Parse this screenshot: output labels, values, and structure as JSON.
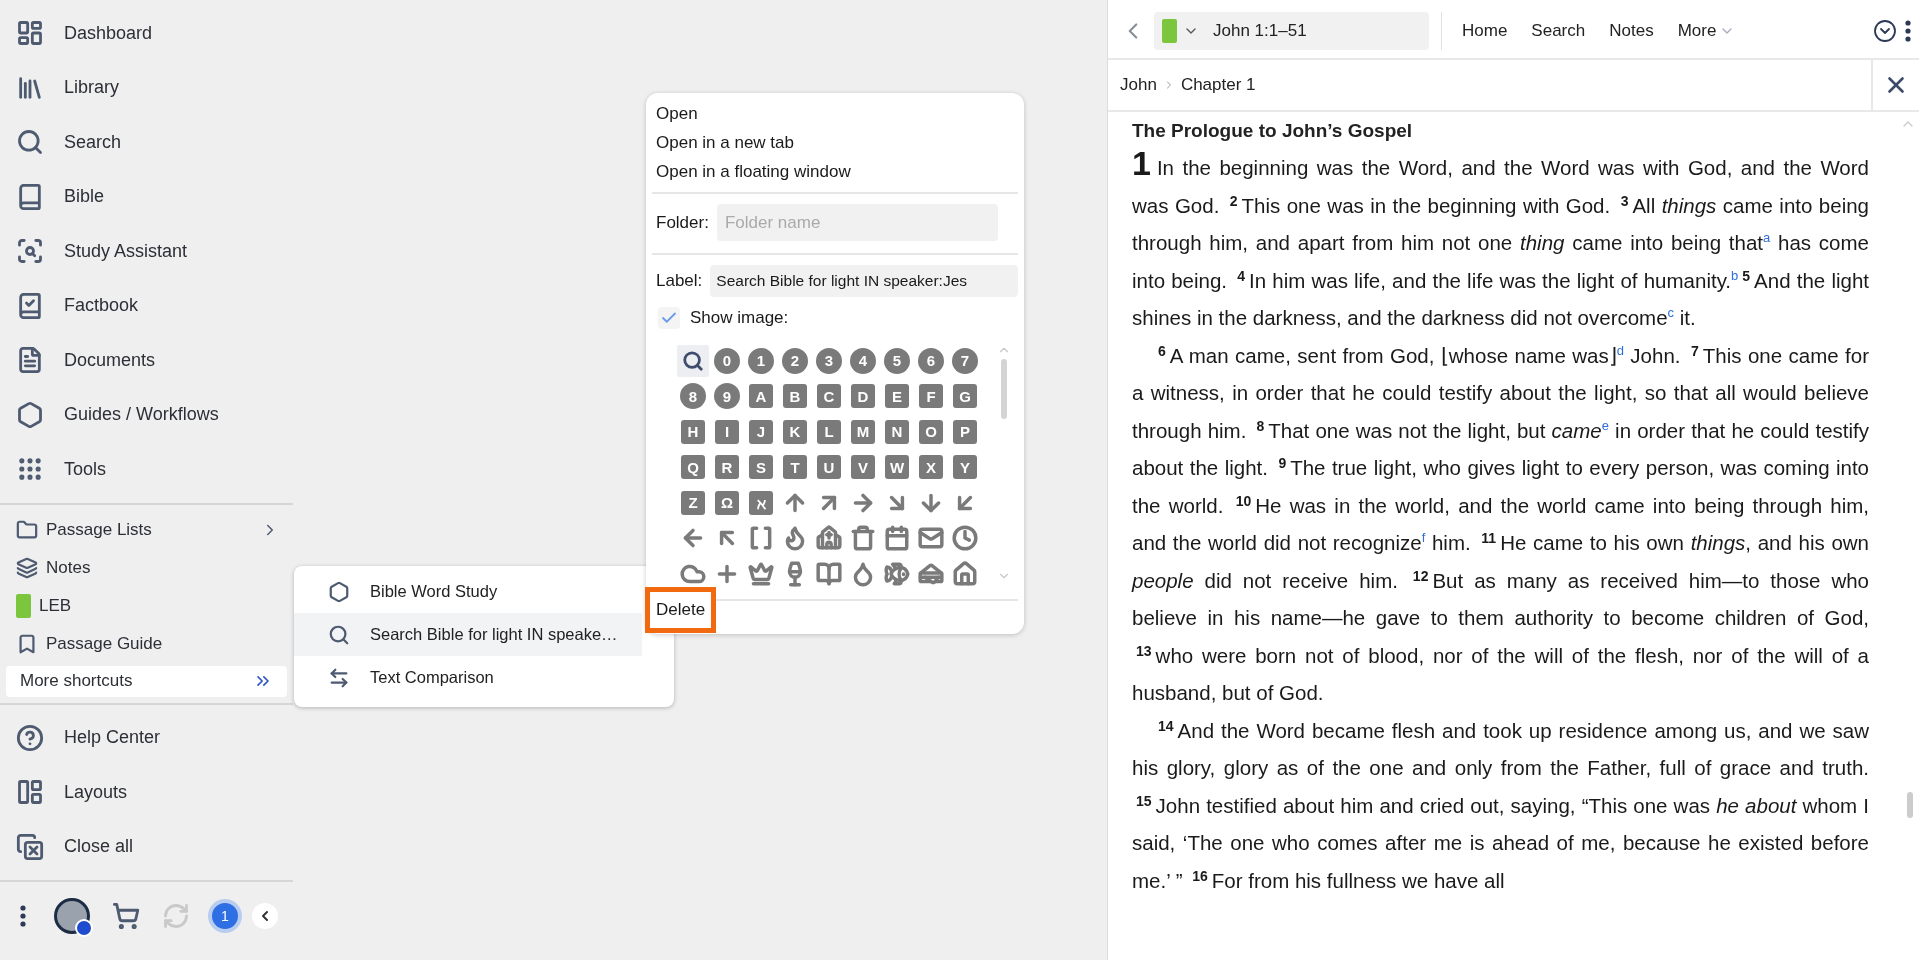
{
  "sidebar": {
    "nav": [
      {
        "label": "Dashboard"
      },
      {
        "label": "Library"
      },
      {
        "label": "Search"
      },
      {
        "label": "Bible"
      },
      {
        "label": "Study Assistant"
      },
      {
        "label": "Factbook"
      },
      {
        "label": "Documents"
      },
      {
        "label": "Guides / Workflows"
      },
      {
        "label": "Tools"
      }
    ],
    "shortcuts": [
      {
        "label": "Passage Lists",
        "kind": "folder",
        "selected": false
      },
      {
        "label": "Notes",
        "kind": "item",
        "selected": false
      },
      {
        "label": "LEB",
        "kind": "item",
        "selected": false
      },
      {
        "label": "Passage Guide",
        "kind": "item",
        "selected": false
      },
      {
        "label": "More shortcuts",
        "kind": "more",
        "selected": true
      }
    ],
    "footer": [
      {
        "label": "Help Center"
      },
      {
        "label": "Layouts"
      },
      {
        "label": "Close all"
      }
    ],
    "bottom_bar": {
      "notification_count": "1"
    }
  },
  "shortcut_menu": {
    "items": [
      {
        "label": "Bible Word Study",
        "selected": false
      },
      {
        "label": "Search Bible for light IN speake…",
        "selected": true
      },
      {
        "label": "Text Comparison",
        "selected": false
      }
    ]
  },
  "shortcut_editor": {
    "actions": [
      "Open",
      "Open in a new tab",
      "Open in a floating window"
    ],
    "folder": {
      "label": "Folder:",
      "placeholder": "Folder name"
    },
    "label_field": {
      "label": "Label:",
      "value": "Search Bible for light IN speaker:Jes"
    },
    "show_image": {
      "label": "Show image:",
      "checked": true
    },
    "images": [
      {
        "kind": "search",
        "selected": true
      },
      {
        "kind": "circle",
        "text": "0",
        "selected": false
      },
      {
        "kind": "circle",
        "text": "1",
        "selected": false
      },
      {
        "kind": "circle",
        "text": "2",
        "selected": false
      },
      {
        "kind": "circle",
        "text": "3",
        "selected": false
      },
      {
        "kind": "circle",
        "text": "4",
        "selected": false
      },
      {
        "kind": "circle",
        "text": "5",
        "selected": false
      },
      {
        "kind": "circle",
        "text": "6",
        "selected": false
      },
      {
        "kind": "circle",
        "text": "7",
        "selected": false
      },
      {
        "kind": "circle",
        "text": "8",
        "selected": false
      },
      {
        "kind": "circle",
        "text": "9",
        "selected": false
      },
      {
        "kind": "square",
        "text": "A",
        "selected": false
      },
      {
        "kind": "square",
        "text": "B",
        "selected": false
      },
      {
        "kind": "square",
        "text": "C",
        "selected": false
      },
      {
        "kind": "square",
        "text": "D",
        "selected": false
      },
      {
        "kind": "square",
        "text": "E",
        "selected": false
      },
      {
        "kind": "square",
        "text": "F",
        "selected": false
      },
      {
        "kind": "square",
        "text": "G",
        "selected": false
      },
      {
        "kind": "square",
        "text": "H",
        "selected": false
      },
      {
        "kind": "square",
        "text": "I",
        "selected": false
      },
      {
        "kind": "square",
        "text": "J",
        "selected": false
      },
      {
        "kind": "square",
        "text": "K",
        "selected": false
      },
      {
        "kind": "square",
        "text": "L",
        "selected": false
      },
      {
        "kind": "square",
        "text": "M",
        "selected": false
      },
      {
        "kind": "square",
        "text": "N",
        "selected": false
      },
      {
        "kind": "square",
        "text": "O",
        "selected": false
      },
      {
        "kind": "square",
        "text": "P",
        "selected": false
      },
      {
        "kind": "square",
        "text": "Q",
        "selected": false
      },
      {
        "kind": "square",
        "text": "R",
        "selected": false
      },
      {
        "kind": "square",
        "text": "S",
        "selected": false
      },
      {
        "kind": "square",
        "text": "T",
        "selected": false
      },
      {
        "kind": "square",
        "text": "U",
        "selected": false
      },
      {
        "kind": "square",
        "text": "V",
        "selected": false
      },
      {
        "kind": "square",
        "text": "W",
        "selected": false
      },
      {
        "kind": "square",
        "text": "X",
        "selected": false
      },
      {
        "kind": "square",
        "text": "Y",
        "selected": false
      },
      {
        "kind": "square",
        "text": "Z",
        "selected": false
      },
      {
        "kind": "square",
        "text": "Ω",
        "selected": false
      },
      {
        "kind": "square",
        "text": "ℵ",
        "selected": false
      },
      {
        "kind": "glyph",
        "selected": false
      },
      {
        "kind": "glyph",
        "selected": false
      },
      {
        "kind": "glyph",
        "selected": false
      },
      {
        "kind": "glyph",
        "selected": false
      },
      {
        "kind": "glyph",
        "selected": false
      },
      {
        "kind": "glyph",
        "selected": false
      },
      {
        "kind": "glyph",
        "selected": false
      },
      {
        "kind": "glyph",
        "selected": false
      },
      {
        "kind": "glyph",
        "selected": false
      },
      {
        "kind": "glyph",
        "selected": false
      },
      {
        "kind": "glyph",
        "selected": false
      },
      {
        "kind": "glyph",
        "selected": false
      },
      {
        "kind": "glyph",
        "selected": false
      },
      {
        "kind": "glyph",
        "selected": false
      },
      {
        "kind": "glyph",
        "selected": false
      },
      {
        "kind": "glyph",
        "selected": false
      },
      {
        "kind": "glyph",
        "selected": false
      },
      {
        "kind": "glyph",
        "selected": false
      },
      {
        "kind": "glyph",
        "selected": false
      },
      {
        "kind": "glyph",
        "selected": false
      },
      {
        "kind": "glyph",
        "selected": false
      },
      {
        "kind": "glyph",
        "selected": false
      },
      {
        "kind": "glyph",
        "selected": false
      },
      {
        "kind": "glyph",
        "selected": false
      }
    ],
    "delete_button": "Delete"
  },
  "reader": {
    "toolbar": {
      "resource": "John 1:1–51",
      "tabs": [
        {
          "label": "Home",
          "kind": "link"
        },
        {
          "label": "Search",
          "kind": "link"
        },
        {
          "label": "Notes",
          "kind": "link"
        },
        {
          "label": "More",
          "kind": "menu"
        }
      ]
    },
    "breadcrumb": [
      "John",
      "Chapter 1"
    ],
    "heading": "The Prologue to John’s Gospel",
    "paragraphs": [
      {
        "indent": false,
        "segments": [
          {
            "kind": "chapter",
            "text": "1"
          },
          {
            "kind": "text",
            "text": "In the beginning was the Word, and the Word was with God, and the Word was God. "
          },
          {
            "kind": "verse",
            "text": "2"
          },
          {
            "kind": "text",
            "text": "This one was in the beginning with God. "
          },
          {
            "kind": "verse",
            "text": "3"
          },
          {
            "kind": "text",
            "text": "All *things* came into being through him, and apart from him not one *thing* came into being that"
          },
          {
            "kind": "note",
            "text": "a"
          },
          {
            "kind": "text",
            "text": " has come into being. "
          },
          {
            "kind": "verse",
            "text": "4"
          },
          {
            "kind": "text",
            "text": "In him was life, and the life was the light of humanity."
          },
          {
            "kind": "note",
            "text": "b"
          },
          {
            "kind": "verse",
            "text": "5"
          },
          {
            "kind": "text",
            "text": "And the light shines in the darkness, and the darkness did not overcome"
          },
          {
            "kind": "note",
            "text": "c"
          },
          {
            "kind": "text",
            "text": " it."
          }
        ]
      },
      {
        "indent": true,
        "segments": [
          {
            "kind": "verse",
            "text": "6"
          },
          {
            "kind": "text",
            "text": "A man came, sent from God, ⌊whose name was⌋"
          },
          {
            "kind": "note",
            "text": "d"
          },
          {
            "kind": "text",
            "text": " John. "
          },
          {
            "kind": "verse",
            "text": "7"
          },
          {
            "kind": "text",
            "text": "This one came for a witness, in order that he could testify about the light, so that all would believe through him. "
          },
          {
            "kind": "verse",
            "text": "8"
          },
          {
            "kind": "text",
            "text": "That one was not the light, but *came*"
          },
          {
            "kind": "note",
            "text": "e"
          },
          {
            "kind": "text",
            "text": " in order that he could testify about the light. "
          },
          {
            "kind": "verse",
            "text": "9"
          },
          {
            "kind": "text",
            "text": "The true light, who gives light to every person, was coming into the world. "
          },
          {
            "kind": "verse",
            "text": "10"
          },
          {
            "kind": "text",
            "text": "He was in the world, and the world came into being through him, and the world did not recognize"
          },
          {
            "kind": "note",
            "text": "f"
          },
          {
            "kind": "text",
            "text": " him. "
          },
          {
            "kind": "verse",
            "text": "11"
          },
          {
            "kind": "text",
            "text": "He came to his own *things*, and his own *people* did not receive him. "
          },
          {
            "kind": "verse",
            "text": "12"
          },
          {
            "kind": "text",
            "text": "But as many as received him—to those who believe in his name—he gave to them authority to become children of God, "
          },
          {
            "kind": "verse",
            "text": "13"
          },
          {
            "kind": "text",
            "text": "who were born not of blood, nor of the will of the flesh, nor of the will of a husband, but of God."
          }
        ]
      },
      {
        "indent": true,
        "segments": [
          {
            "kind": "verse",
            "text": "14"
          },
          {
            "kind": "text",
            "text": "And the Word became flesh and took up residence among us, and we saw his glory, glory as of the one and only from the Father, full of grace and truth. "
          },
          {
            "kind": "verse",
            "text": "15"
          },
          {
            "kind": "text",
            "text": "John testified about him and cried out, saying, “This one was *he about* whom I said, ‘The one who comes after me is ahead of me, because he existed before me.’ ” "
          },
          {
            "kind": "verse",
            "text": "16"
          },
          {
            "kind": "text",
            "text": "For from his fullness we have all"
          }
        ]
      }
    ]
  }
}
